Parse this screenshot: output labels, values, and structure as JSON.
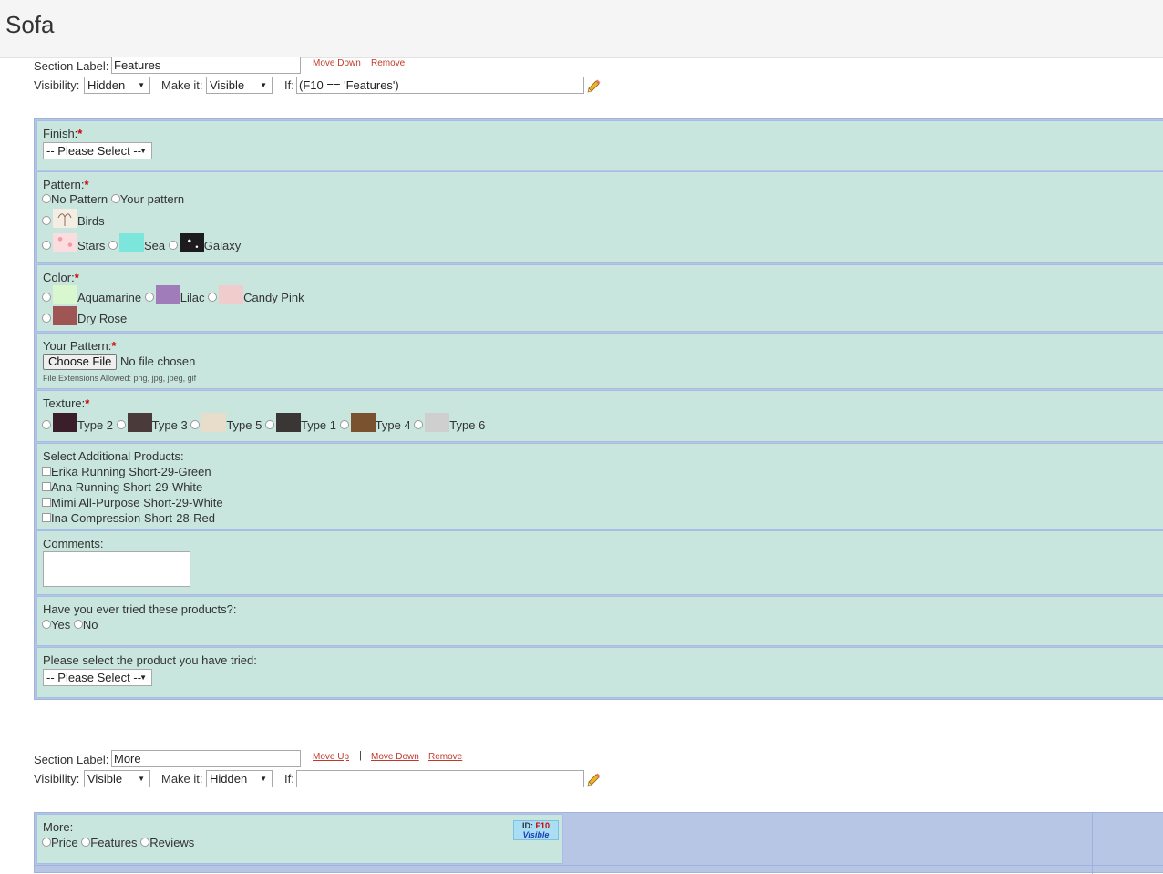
{
  "page_title": "Sofa",
  "section1": {
    "label_caption": "Section Label:",
    "label_value": "Features",
    "move_down": "Move Down",
    "remove": "Remove",
    "visibility_caption": "Visibility:",
    "visibility_value": "Hidden",
    "make_it_caption": "Make it:",
    "make_it_value": "Visible",
    "if_caption": "If:",
    "if_value": "(F10 == 'Features')"
  },
  "fields": {
    "finish": {
      "label": "Finish:",
      "select": "-- Please Select --"
    },
    "pattern": {
      "label": "Pattern:",
      "options": [
        "No Pattern",
        "Your pattern",
        "Birds",
        "Stars",
        "Sea",
        "Galaxy"
      ]
    },
    "color": {
      "label": "Color:",
      "options": [
        {
          "name": "Aquamarine",
          "color": "#d9f7cf"
        },
        {
          "name": "Lilac",
          "color": "#a07cba"
        },
        {
          "name": "Candy Pink",
          "color": "#f1cccc"
        },
        {
          "name": "Dry Rose",
          "color": "#a05555"
        }
      ]
    },
    "your_pattern": {
      "label": "Your Pattern:",
      "button": "Choose File",
      "status": "No file chosen",
      "hint": "File Extensions Allowed: png, jpg, jpeg, gif"
    },
    "texture": {
      "label": "Texture:",
      "options": [
        {
          "name": "Type 2",
          "color": "#3a1f2a"
        },
        {
          "name": "Type 3",
          "color": "#4a3b3a"
        },
        {
          "name": "Type 5",
          "color": "#e8dccb"
        },
        {
          "name": "Type 1",
          "color": "#3a3636"
        },
        {
          "name": "Type 4",
          "color": "#7a5230"
        },
        {
          "name": "Type 6",
          "color": "#cfcfcf"
        }
      ]
    },
    "additional": {
      "label": "Select Additional Products:",
      "items": [
        "Erika Running Short-29-Green",
        "Ana Running Short-29-White",
        "Mimi All-Purpose Short-29-White",
        "Ina Compression Short-28-Red"
      ]
    },
    "comments": {
      "label": "Comments:"
    },
    "tried": {
      "label": "Have you ever tried these products?:",
      "options": [
        "Yes",
        "No"
      ]
    },
    "tried_product": {
      "label": "Please select the product you have tried:",
      "select": "-- Please Select --"
    }
  },
  "section2": {
    "label_caption": "Section Label:",
    "label_value": "More",
    "move_up": "Move Up",
    "separator": "|",
    "move_down": "Move Down",
    "remove": "Remove",
    "visibility_caption": "Visibility:",
    "visibility_value": "Visible",
    "make_it_caption": "Make it:",
    "make_it_value": "Hidden",
    "if_caption": "If:",
    "if_value": ""
  },
  "more_field": {
    "label": "More:",
    "options": [
      "Price",
      "Features",
      "Reviews"
    ],
    "badge_id_caption": "ID:",
    "badge_id": "F10",
    "badge_status": "Visible"
  },
  "colors": {
    "field_bg": "#c8e5de",
    "grid_bg": "#b8c6e6",
    "link": "#c0392b",
    "required": "#cc0000"
  }
}
